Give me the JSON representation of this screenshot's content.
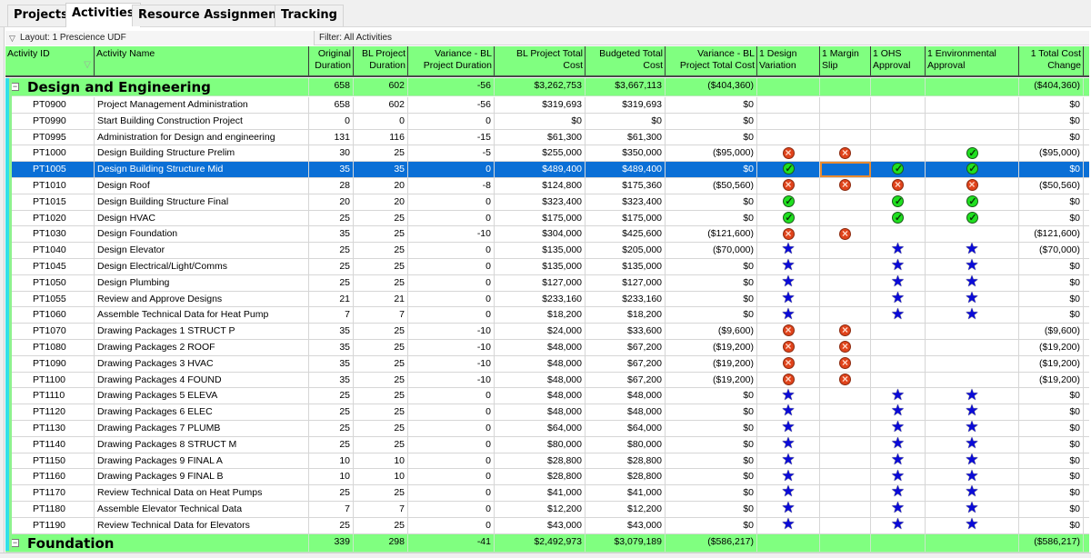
{
  "tabs": [
    {
      "label": "Projects",
      "active": false
    },
    {
      "label": "Activities",
      "active": true
    },
    {
      "label": "Resource Assignments",
      "active": false
    },
    {
      "label": "Tracking",
      "active": false
    }
  ],
  "layout_label": "Layout: 1 Prescience  UDF",
  "filter_label": "Filter: All Activities",
  "columns": [
    {
      "key": "id",
      "label": "Activity ID"
    },
    {
      "key": "name",
      "label": "Activity Name"
    },
    {
      "key": "orig_dur",
      "label": "Original Duration"
    },
    {
      "key": "bl_dur",
      "label": "BL Project Duration"
    },
    {
      "key": "var_dur",
      "label": "Variance - BL Project Duration"
    },
    {
      "key": "bl_cost",
      "label": "BL Project Total Cost"
    },
    {
      "key": "bud_cost",
      "label": "Budgeted Total Cost"
    },
    {
      "key": "var_cost",
      "label": "Variance - BL Project Total Cost"
    },
    {
      "key": "design_var",
      "label": "1 Design Variation"
    },
    {
      "key": "margin_slip",
      "label": "1 Margin Slip"
    },
    {
      "key": "ohs",
      "label": "1 OHS Approval"
    },
    {
      "key": "env",
      "label": "1 Environmental Approval"
    },
    {
      "key": "cost_change",
      "label": "1 Total Cost Change"
    }
  ],
  "icon_legend": {
    "x": "red-cross-icon",
    "ok": "green-check-icon",
    "star": "blue-star-icon"
  },
  "groups": [
    {
      "name": "Design and Engineering",
      "orig_dur": "658",
      "bl_dur": "602",
      "var_dur": "-56",
      "bl_cost": "$3,262,753",
      "bud_cost": "$3,667,113",
      "var_cost": "($404,360)",
      "cost_change": "($404,360)",
      "activities": [
        {
          "id": "PT0900",
          "name": "Project Management Administration",
          "orig_dur": "658",
          "bl_dur": "602",
          "var_dur": "-56",
          "bl_cost": "$319,693",
          "bud_cost": "$319,693",
          "var_cost": "$0",
          "design_var": "",
          "margin_slip": "",
          "ohs": "",
          "env": "",
          "cost_change": "$0"
        },
        {
          "id": "PT0990",
          "name": "Start Building Construction Project",
          "orig_dur": "0",
          "bl_dur": "0",
          "var_dur": "0",
          "bl_cost": "$0",
          "bud_cost": "$0",
          "var_cost": "$0",
          "design_var": "",
          "margin_slip": "",
          "ohs": "",
          "env": "",
          "cost_change": "$0"
        },
        {
          "id": "PT0995",
          "name": "Administration for Design and engineering",
          "orig_dur": "131",
          "bl_dur": "116",
          "var_dur": "-15",
          "bl_cost": "$61,300",
          "bud_cost": "$61,300",
          "var_cost": "$0",
          "design_var": "",
          "margin_slip": "",
          "ohs": "",
          "env": "",
          "cost_change": "$0"
        },
        {
          "id": "PT1000",
          "name": "Design Building Structure Prelim",
          "orig_dur": "30",
          "bl_dur": "25",
          "var_dur": "-5",
          "bl_cost": "$255,000",
          "bud_cost": "$350,000",
          "var_cost": "($95,000)",
          "design_var": "x",
          "margin_slip": "x",
          "ohs": "",
          "env": "ok",
          "cost_change": "($95,000)"
        },
        {
          "id": "PT1005",
          "name": "Design Building Structure Mid",
          "orig_dur": "35",
          "bl_dur": "35",
          "var_dur": "0",
          "bl_cost": "$489,400",
          "bud_cost": "$489,400",
          "var_cost": "$0",
          "design_var": "ok",
          "margin_slip": "",
          "ohs": "ok",
          "env": "ok",
          "cost_change": "$0",
          "selected": true
        },
        {
          "id": "PT1010",
          "name": "Design Roof",
          "orig_dur": "28",
          "bl_dur": "20",
          "var_dur": "-8",
          "bl_cost": "$124,800",
          "bud_cost": "$175,360",
          "var_cost": "($50,560)",
          "design_var": "x",
          "margin_slip": "x",
          "ohs": "x",
          "env": "x",
          "cost_change": "($50,560)"
        },
        {
          "id": "PT1015",
          "name": "Design Building Structure Final",
          "orig_dur": "20",
          "bl_dur": "20",
          "var_dur": "0",
          "bl_cost": "$323,400",
          "bud_cost": "$323,400",
          "var_cost": "$0",
          "design_var": "ok",
          "margin_slip": "",
          "ohs": "ok",
          "env": "ok",
          "cost_change": "$0"
        },
        {
          "id": "PT1020",
          "name": "Design HVAC",
          "orig_dur": "25",
          "bl_dur": "25",
          "var_dur": "0",
          "bl_cost": "$175,000",
          "bud_cost": "$175,000",
          "var_cost": "$0",
          "design_var": "ok",
          "margin_slip": "",
          "ohs": "ok",
          "env": "ok",
          "cost_change": "$0"
        },
        {
          "id": "PT1030",
          "name": "Design Foundation",
          "orig_dur": "35",
          "bl_dur": "25",
          "var_dur": "-10",
          "bl_cost": "$304,000",
          "bud_cost": "$425,600",
          "var_cost": "($121,600)",
          "design_var": "x",
          "margin_slip": "x",
          "ohs": "",
          "env": "",
          "cost_change": "($121,600)"
        },
        {
          "id": "PT1040",
          "name": "Design Elevator",
          "orig_dur": "25",
          "bl_dur": "25",
          "var_dur": "0",
          "bl_cost": "$135,000",
          "bud_cost": "$205,000",
          "var_cost": "($70,000)",
          "design_var": "star",
          "margin_slip": "",
          "ohs": "star",
          "env": "star",
          "cost_change": "($70,000)"
        },
        {
          "id": "PT1045",
          "name": "Design Electrical/Light/Comms",
          "orig_dur": "25",
          "bl_dur": "25",
          "var_dur": "0",
          "bl_cost": "$135,000",
          "bud_cost": "$135,000",
          "var_cost": "$0",
          "design_var": "star",
          "margin_slip": "",
          "ohs": "star",
          "env": "star",
          "cost_change": "$0"
        },
        {
          "id": "PT1050",
          "name": "Design Plumbing",
          "orig_dur": "25",
          "bl_dur": "25",
          "var_dur": "0",
          "bl_cost": "$127,000",
          "bud_cost": "$127,000",
          "var_cost": "$0",
          "design_var": "star",
          "margin_slip": "",
          "ohs": "star",
          "env": "star",
          "cost_change": "$0"
        },
        {
          "id": "PT1055",
          "name": "Review and Approve Designs",
          "orig_dur": "21",
          "bl_dur": "21",
          "var_dur": "0",
          "bl_cost": "$233,160",
          "bud_cost": "$233,160",
          "var_cost": "$0",
          "design_var": "star",
          "margin_slip": "",
          "ohs": "star",
          "env": "star",
          "cost_change": "$0"
        },
        {
          "id": "PT1060",
          "name": "Assemble Technical Data for Heat Pump",
          "orig_dur": "7",
          "bl_dur": "7",
          "var_dur": "0",
          "bl_cost": "$18,200",
          "bud_cost": "$18,200",
          "var_cost": "$0",
          "design_var": "star",
          "margin_slip": "",
          "ohs": "star",
          "env": "star",
          "cost_change": "$0"
        },
        {
          "id": "PT1070",
          "name": "Drawing Packages 1 STRUCT P",
          "orig_dur": "35",
          "bl_dur": "25",
          "var_dur": "-10",
          "bl_cost": "$24,000",
          "bud_cost": "$33,600",
          "var_cost": "($9,600)",
          "design_var": "x",
          "margin_slip": "x",
          "ohs": "",
          "env": "",
          "cost_change": "($9,600)"
        },
        {
          "id": "PT1080",
          "name": "Drawing Packages 2 ROOF",
          "orig_dur": "35",
          "bl_dur": "25",
          "var_dur": "-10",
          "bl_cost": "$48,000",
          "bud_cost": "$67,200",
          "var_cost": "($19,200)",
          "design_var": "x",
          "margin_slip": "x",
          "ohs": "",
          "env": "",
          "cost_change": "($19,200)"
        },
        {
          "id": "PT1090",
          "name": "Drawing Packages 3 HVAC",
          "orig_dur": "35",
          "bl_dur": "25",
          "var_dur": "-10",
          "bl_cost": "$48,000",
          "bud_cost": "$67,200",
          "var_cost": "($19,200)",
          "design_var": "x",
          "margin_slip": "x",
          "ohs": "",
          "env": "",
          "cost_change": "($19,200)"
        },
        {
          "id": "PT1100",
          "name": "Drawing Packages 4 FOUND",
          "orig_dur": "35",
          "bl_dur": "25",
          "var_dur": "-10",
          "bl_cost": "$48,000",
          "bud_cost": "$67,200",
          "var_cost": "($19,200)",
          "design_var": "x",
          "margin_slip": "x",
          "ohs": "",
          "env": "",
          "cost_change": "($19,200)"
        },
        {
          "id": "PT1110",
          "name": "Drawing Packages 5 ELEVA",
          "orig_dur": "25",
          "bl_dur": "25",
          "var_dur": "0",
          "bl_cost": "$48,000",
          "bud_cost": "$48,000",
          "var_cost": "$0",
          "design_var": "star",
          "margin_slip": "",
          "ohs": "star",
          "env": "star",
          "cost_change": "$0"
        },
        {
          "id": "PT1120",
          "name": "Drawing Packages 6 ELEC",
          "orig_dur": "25",
          "bl_dur": "25",
          "var_dur": "0",
          "bl_cost": "$48,000",
          "bud_cost": "$48,000",
          "var_cost": "$0",
          "design_var": "star",
          "margin_slip": "",
          "ohs": "star",
          "env": "star",
          "cost_change": "$0"
        },
        {
          "id": "PT1130",
          "name": "Drawing Packages 7 PLUMB",
          "orig_dur": "25",
          "bl_dur": "25",
          "var_dur": "0",
          "bl_cost": "$64,000",
          "bud_cost": "$64,000",
          "var_cost": "$0",
          "design_var": "star",
          "margin_slip": "",
          "ohs": "star",
          "env": "star",
          "cost_change": "$0"
        },
        {
          "id": "PT1140",
          "name": "Drawing Packages 8 STRUCT M",
          "orig_dur": "25",
          "bl_dur": "25",
          "var_dur": "0",
          "bl_cost": "$80,000",
          "bud_cost": "$80,000",
          "var_cost": "$0",
          "design_var": "star",
          "margin_slip": "",
          "ohs": "star",
          "env": "star",
          "cost_change": "$0"
        },
        {
          "id": "PT1150",
          "name": "Drawing Packages 9 FINAL A",
          "orig_dur": "10",
          "bl_dur": "10",
          "var_dur": "0",
          "bl_cost": "$28,800",
          "bud_cost": "$28,800",
          "var_cost": "$0",
          "design_var": "star",
          "margin_slip": "",
          "ohs": "star",
          "env": "star",
          "cost_change": "$0"
        },
        {
          "id": "PT1160",
          "name": "Drawing Packages 9 FINAL B",
          "orig_dur": "10",
          "bl_dur": "10",
          "var_dur": "0",
          "bl_cost": "$28,800",
          "bud_cost": "$28,800",
          "var_cost": "$0",
          "design_var": "star",
          "margin_slip": "",
          "ohs": "star",
          "env": "star",
          "cost_change": "$0"
        },
        {
          "id": "PT1170",
          "name": "Review Technical Data on Heat Pumps",
          "orig_dur": "25",
          "bl_dur": "25",
          "var_dur": "0",
          "bl_cost": "$41,000",
          "bud_cost": "$41,000",
          "var_cost": "$0",
          "design_var": "star",
          "margin_slip": "",
          "ohs": "star",
          "env": "star",
          "cost_change": "$0"
        },
        {
          "id": "PT1180",
          "name": "Assemble Elevator Technical Data",
          "orig_dur": "7",
          "bl_dur": "7",
          "var_dur": "0",
          "bl_cost": "$12,200",
          "bud_cost": "$12,200",
          "var_cost": "$0",
          "design_var": "star",
          "margin_slip": "",
          "ohs": "star",
          "env": "star",
          "cost_change": "$0"
        },
        {
          "id": "PT1190",
          "name": "Review Technical Data for Elevators",
          "orig_dur": "25",
          "bl_dur": "25",
          "var_dur": "0",
          "bl_cost": "$43,000",
          "bud_cost": "$43,000",
          "var_cost": "$0",
          "design_var": "star",
          "margin_slip": "",
          "ohs": "star",
          "env": "star",
          "cost_change": "$0"
        }
      ]
    },
    {
      "name": "Foundation",
      "orig_dur": "339",
      "bl_dur": "298",
      "var_dur": "-41",
      "bl_cost": "$2,492,973",
      "bud_cost": "$3,079,189",
      "var_cost": "($586,217)",
      "cost_change": "($586,217)",
      "activities": []
    }
  ]
}
